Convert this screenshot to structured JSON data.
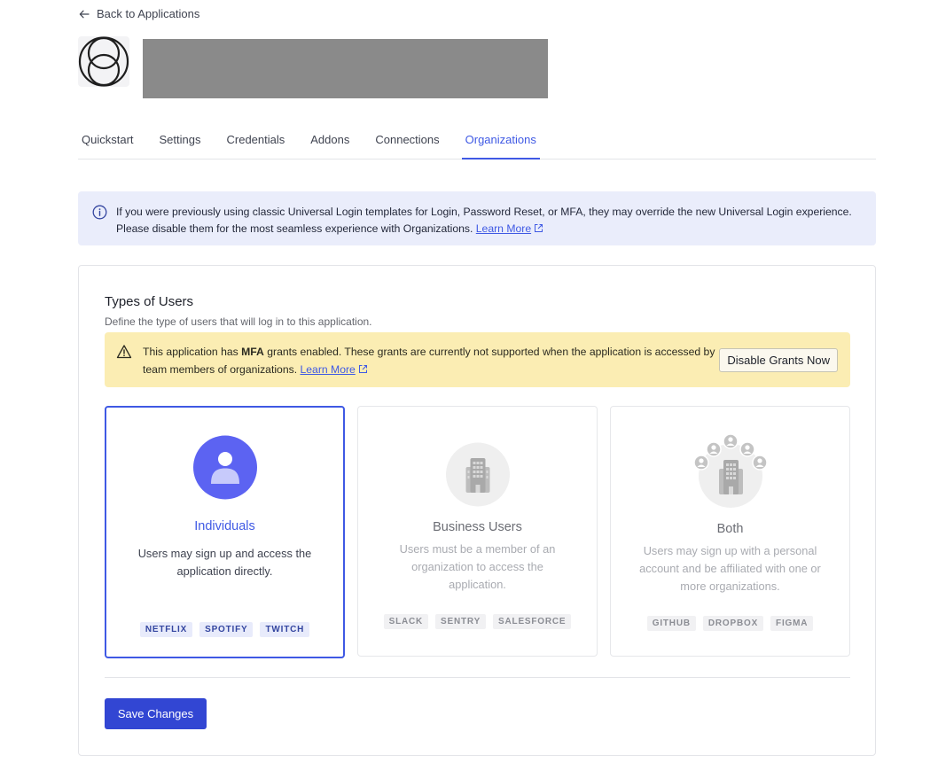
{
  "nav": {
    "back_label": "Back to Applications"
  },
  "tabs": [
    {
      "label": "Quickstart"
    },
    {
      "label": "Settings"
    },
    {
      "label": "Credentials"
    },
    {
      "label": "Addons"
    },
    {
      "label": "Connections"
    },
    {
      "label": "Organizations",
      "active": true
    }
  ],
  "info_banner": {
    "text": "If you were previously using classic Universal Login templates for Login, Password Reset, or MFA, they may override the new Universal Login experience. Please disable them for the most seamless experience with Organizations.",
    "link": "Learn More"
  },
  "types_card": {
    "title": "Types of Users",
    "description": "Define the type of users that will log in to this application.",
    "warning": {
      "prefix": "This application has ",
      "bold": "MFA",
      "suffix": " grants enabled. These grants are currently not supported when the application is accessed by team members of organizations.",
      "link": "Learn More",
      "button": "Disable Grants Now"
    },
    "options": [
      {
        "title": "Individuals",
        "description": "Users may sign up and access the application directly.",
        "chips": [
          "NETFLIX",
          "SPOTIFY",
          "TWITCH"
        ],
        "selected": true
      },
      {
        "title": "Business Users",
        "description": "Users must be a member of an organization to access the application.",
        "chips": [
          "SLACK",
          "SENTRY",
          "SALESFORCE"
        ],
        "selected": false
      },
      {
        "title": "Both",
        "description": "Users may sign up with a personal account and be affiliated with one or more organizations.",
        "chips": [
          "GITHUB",
          "DROPBOX",
          "FIGMA"
        ],
        "selected": false
      }
    ],
    "save_button": "Save Changes"
  },
  "colors": {
    "accent": "#3f59e4",
    "primary_button": "#3246d3",
    "info_bg": "#eaedfb",
    "warning_bg": "#fbedb3"
  }
}
